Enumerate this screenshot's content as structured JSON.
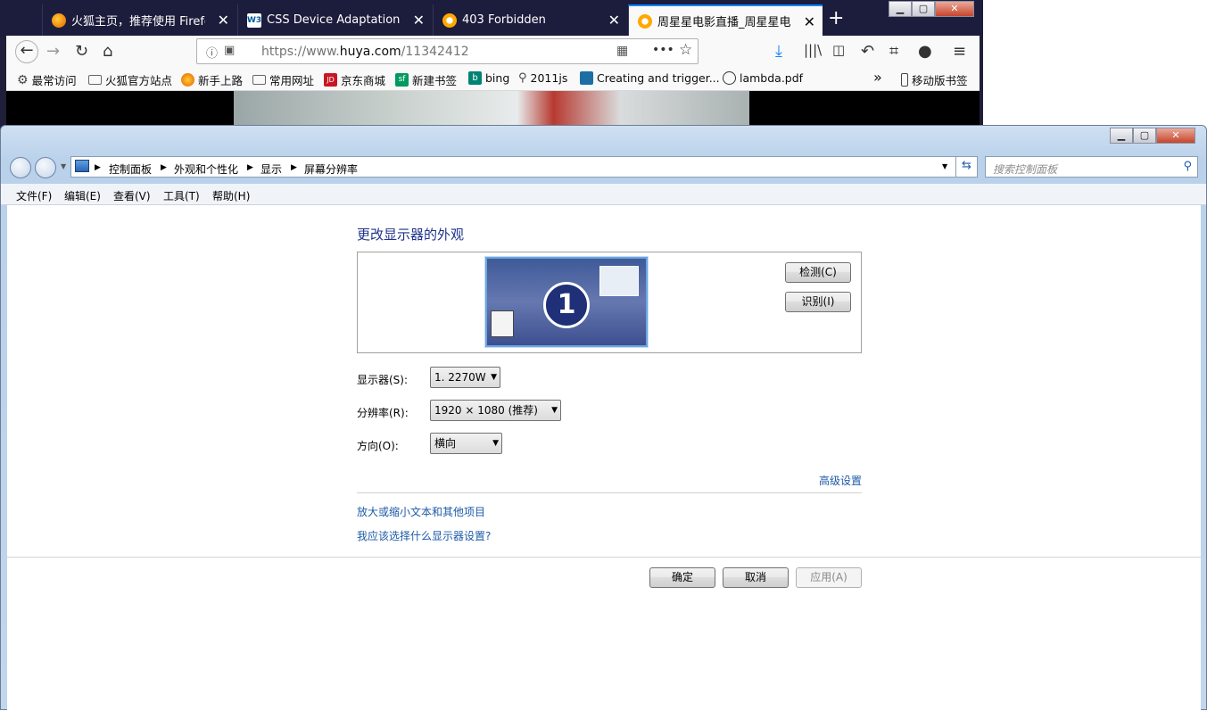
{
  "firefox": {
    "tabs": [
      {
        "title": "火狐主页，推荐使用 Firefox 火",
        "icon": "firefox-icon"
      },
      {
        "title": "CSS Device Adaptation Mod",
        "icon": "w3c-icon"
      },
      {
        "title": "403 Forbidden",
        "icon": "huya-icon"
      },
      {
        "title": "周星星电影直播_周星星电影全",
        "icon": "huya-icon"
      }
    ],
    "url_prefix": "https://www.",
    "url_host": "huya.com",
    "url_path": "/11342412",
    "bookmarks": [
      "最常访问",
      "火狐官方站点",
      "新手上路",
      "常用网址",
      "京东商城",
      "新建书签",
      "bing",
      "2011js",
      "Creating and trigger...",
      "lambda.pdf"
    ],
    "mobile_bookmarks": "移动版书签",
    "colors": {
      "tabstrip": "#1c1c3c",
      "accent": "#0a84ff"
    }
  },
  "cp": {
    "breadcrumb": [
      "控制面板",
      "外观和个性化",
      "显示",
      "屏幕分辨率"
    ],
    "search_placeholder": "搜索控制面板",
    "menu": [
      "文件(F)",
      "编辑(E)",
      "查看(V)",
      "工具(T)",
      "帮助(H)"
    ],
    "heading": "更改显示器的外观",
    "monitor_number": "1",
    "detect_button": "检测(C)",
    "identify_button": "识别(I)",
    "display_label": "显示器(S):",
    "display_value": "1. 2270W",
    "resolution_label": "分辨率(R):",
    "resolution_value": "1920 × 1080 (推荐)",
    "orientation_label": "方向(O):",
    "orientation_value": "横向",
    "advanced_link": "高级设置",
    "link_text_size": "放大或缩小文本和其他项目",
    "link_which_settings": "我应该选择什么显示器设置?",
    "ok_button": "确定",
    "cancel_button": "取消",
    "apply_button": "应用(A)",
    "colors": {
      "heading": "#1e3287",
      "link": "#1e5aa8"
    }
  }
}
